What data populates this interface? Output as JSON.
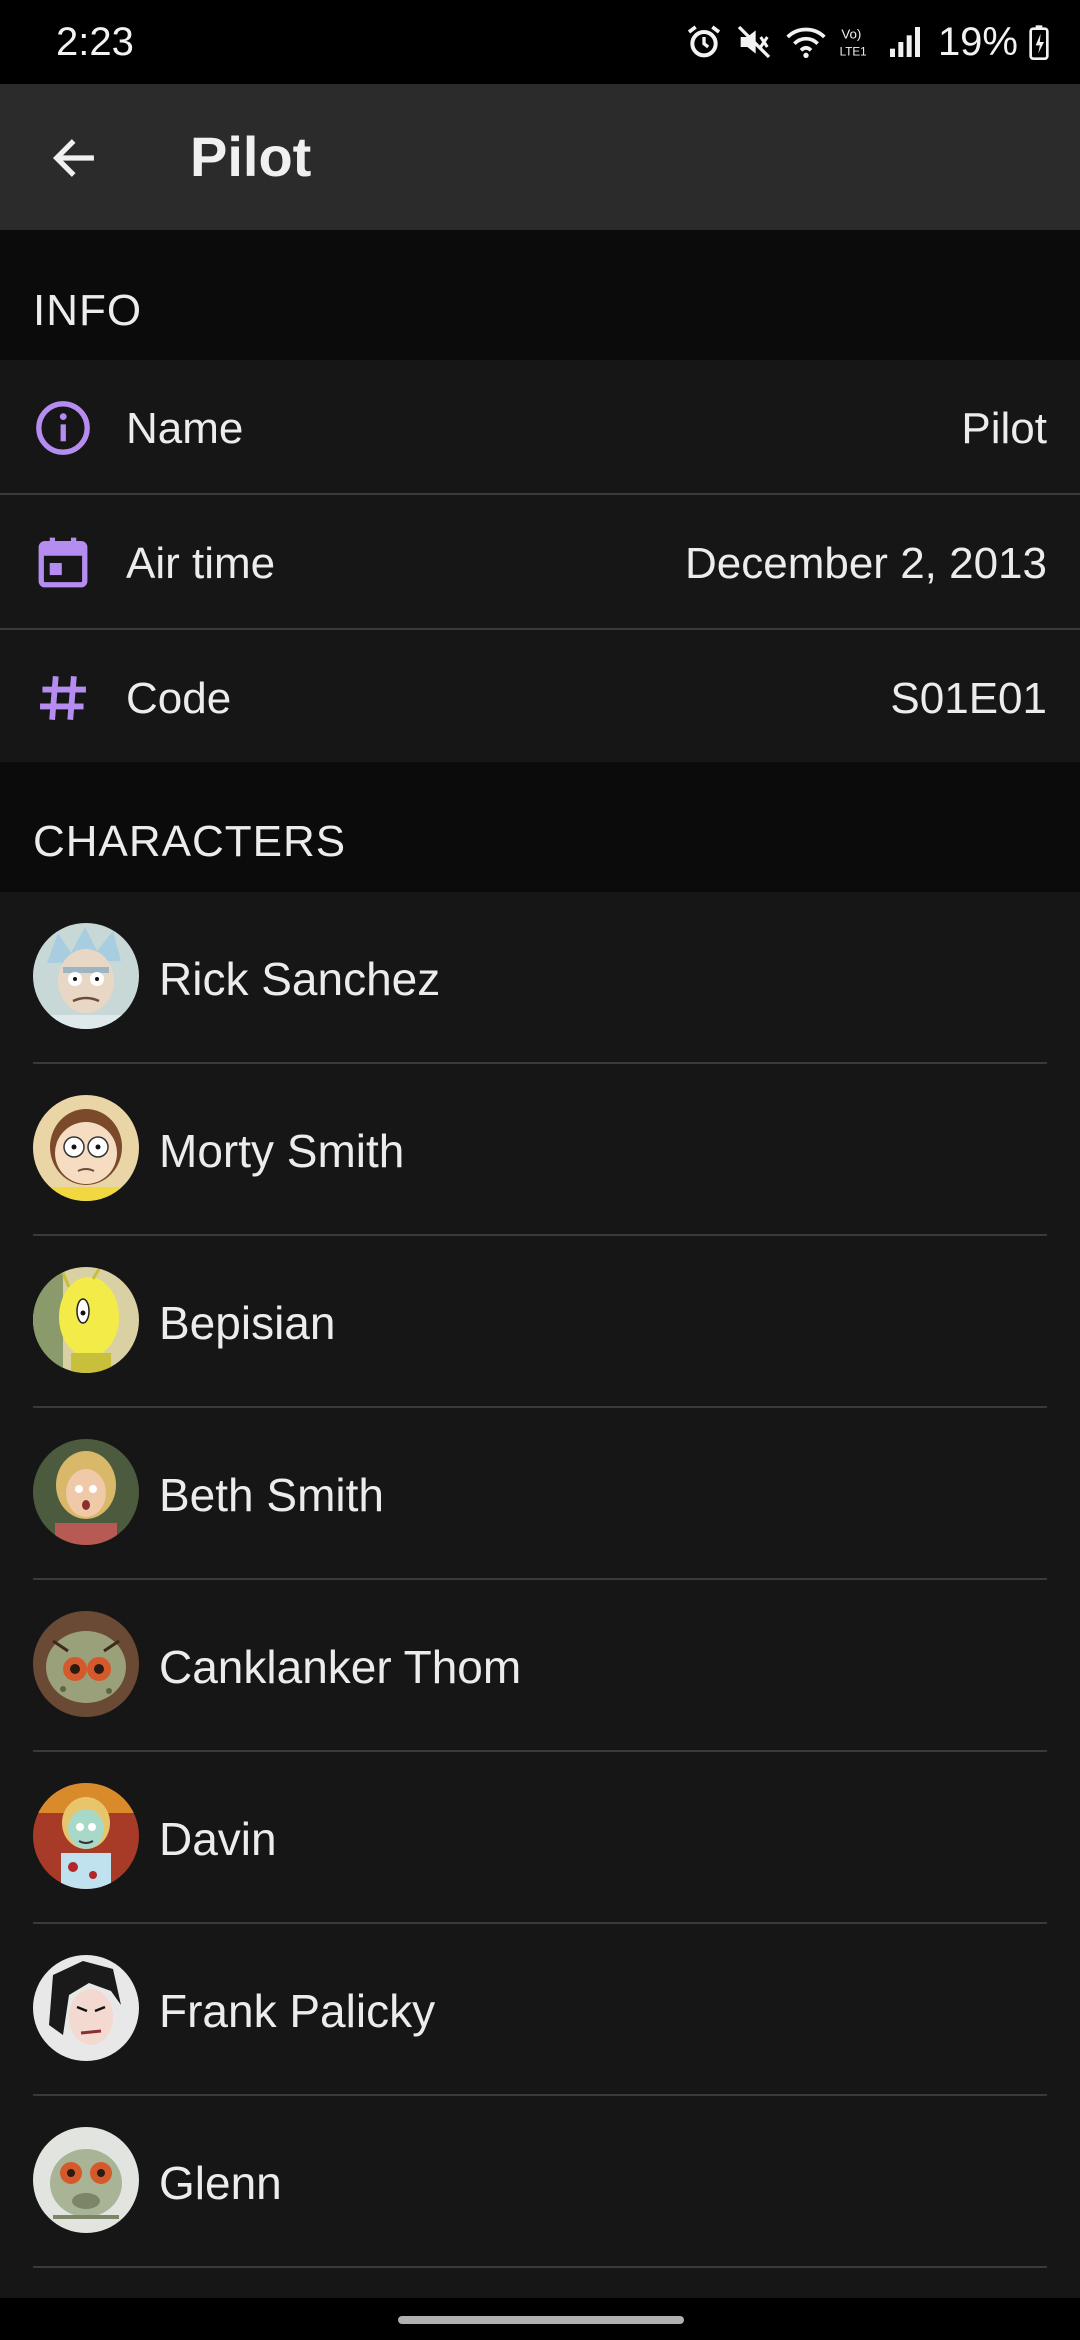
{
  "status_bar": {
    "time": "2:23",
    "volte_label": "Vo) LTE1",
    "battery_percent": "19%"
  },
  "app_bar": {
    "title": "Pilot",
    "back_icon": "arrow-back-icon"
  },
  "info_section": {
    "header": "INFO",
    "rows": [
      {
        "icon": "info-icon",
        "label": "Name",
        "value": "Pilot"
      },
      {
        "icon": "calendar-icon",
        "label": "Air time",
        "value": "December 2, 2013"
      },
      {
        "icon": "hash-icon",
        "label": "Code",
        "value": "S01E01"
      }
    ]
  },
  "characters_section": {
    "header": "CHARACTERS",
    "items": [
      {
        "name": "Rick Sanchez"
      },
      {
        "name": "Morty Smith"
      },
      {
        "name": "Bepisian"
      },
      {
        "name": "Beth Smith"
      },
      {
        "name": "Canklanker Thom"
      },
      {
        "name": "Davin"
      },
      {
        "name": "Frank Palicky"
      },
      {
        "name": "Glenn"
      }
    ]
  },
  "colors": {
    "accent": "#b58cf0",
    "background": "#161616",
    "header_background": "#0b0b0b",
    "app_bar": "#2b2b2b",
    "divider": "#3a3a3a"
  }
}
